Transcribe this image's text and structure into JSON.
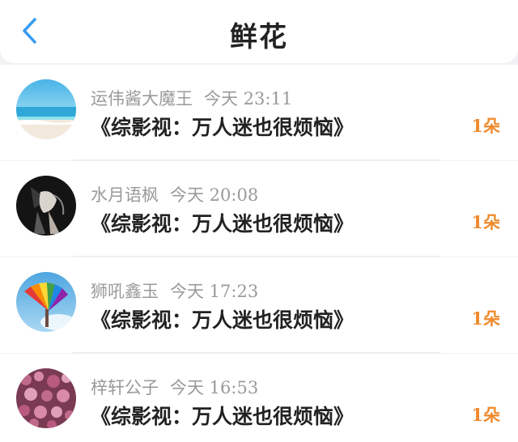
{
  "header": {
    "title": "鲜花",
    "back_icon": "chevron-left-icon"
  },
  "colors": {
    "accent_blue": "#3a9bf0",
    "count_orange": "#f08a2c",
    "meta_gray": "#9a9a9a"
  },
  "items": [
    {
      "username": "运伟酱大魔王",
      "time": "今天 23:11",
      "book": "《综影视：万人迷也很烦恼》",
      "count": "1朵",
      "avatar": "beach-avatar"
    },
    {
      "username": "水月语枫",
      "time": "今天 20:08",
      "book": "《综影视：万人迷也很烦恼》",
      "count": "1朵",
      "avatar": "dark-figure-avatar"
    },
    {
      "username": "狮吼鑫玉",
      "time": "今天 17:23",
      "book": "《综影视：万人迷也很烦恼》",
      "count": "1朵",
      "avatar": "rainbow-fan-avatar"
    },
    {
      "username": "梓轩公子",
      "time": "今天 16:53",
      "book": "《综影视：万人迷也很烦恼》",
      "count": "1朵",
      "avatar": "flowers-avatar"
    }
  ]
}
